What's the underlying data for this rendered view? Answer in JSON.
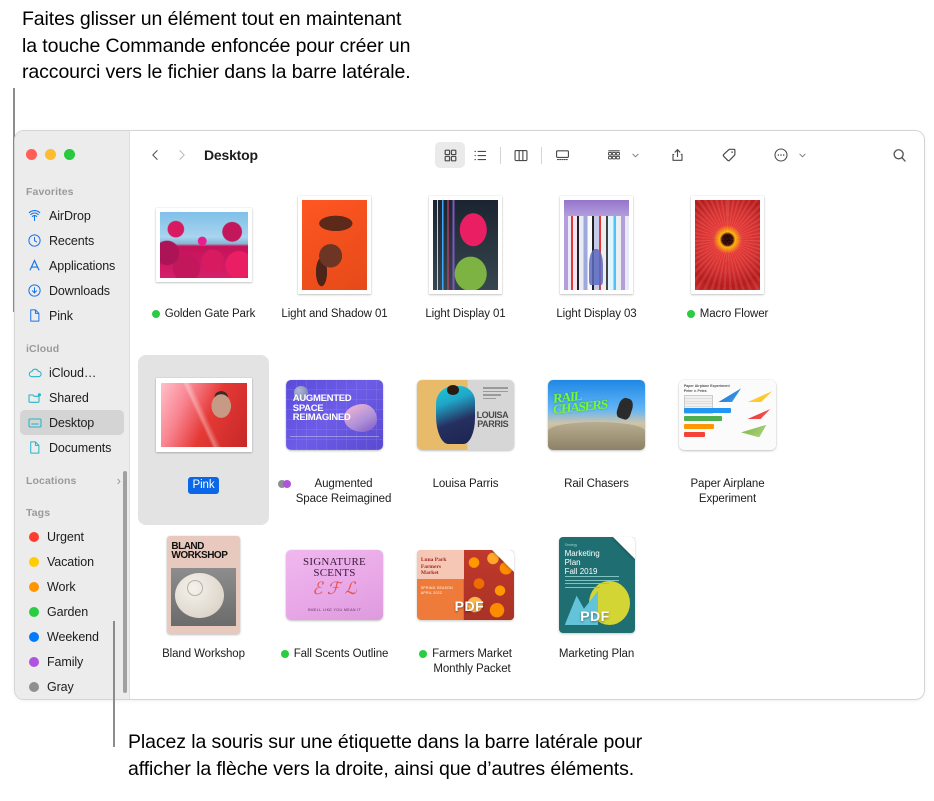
{
  "captions": {
    "top": "Faites glisser un élément tout en maintenant\nla touche Commande enfoncée pour créer un\nraccourci vers le fichier dans la barre latérale.",
    "bottom": "Placez la souris sur une étiquette dans la barre latérale pour\nafficher la flèche vers la droite, ainsi que d’autres éléments."
  },
  "window": {
    "traffic_lights": [
      "close",
      "minimize",
      "zoom"
    ],
    "colors": {
      "close": "#ff5f57",
      "minimize": "#febc2e",
      "zoom": "#28c840",
      "selection_blue": "#0a68e8",
      "sidebar_bg": "#ececec",
      "selected_row": "#d4d4d4"
    }
  },
  "sidebar": {
    "sections": [
      {
        "header": "Favorites",
        "items": [
          {
            "label": "AirDrop",
            "icon": "airdrop-icon",
            "selected": false
          },
          {
            "label": "Recents",
            "icon": "clock-icon",
            "selected": false
          },
          {
            "label": "Applications",
            "icon": "app-store-icon",
            "selected": false
          },
          {
            "label": "Downloads",
            "icon": "download-icon",
            "selected": false
          },
          {
            "label": "Pink",
            "icon": "document-icon",
            "selected": false
          }
        ]
      },
      {
        "header": "iCloud",
        "items": [
          {
            "label": "iCloud…",
            "icon": "cloud-icon",
            "selected": false
          },
          {
            "label": "Shared",
            "icon": "shared-folder-icon",
            "selected": false
          },
          {
            "label": "Desktop",
            "icon": "desktop-icon",
            "selected": true
          },
          {
            "label": "Documents",
            "icon": "document-icon",
            "selected": false
          }
        ]
      },
      {
        "header": "Locations",
        "chevron": "›",
        "items": []
      },
      {
        "header": "Tags",
        "items": [
          {
            "label": "Urgent",
            "icon": "tag-dot",
            "color": "#ff3b30"
          },
          {
            "label": "Vacation",
            "icon": "tag-dot",
            "color": "#ffcc00"
          },
          {
            "label": "Work",
            "icon": "tag-dot",
            "color": "#ff9500"
          },
          {
            "label": "Garden",
            "icon": "tag-dot",
            "color": "#28cd41"
          },
          {
            "label": "Weekend",
            "icon": "tag-dot",
            "color": "#007aff"
          },
          {
            "label": "Family",
            "icon": "tag-dot",
            "color": "#af52de"
          },
          {
            "label": "Gray",
            "icon": "tag-dot",
            "color": "#8e8e93"
          }
        ]
      }
    ]
  },
  "toolbar": {
    "back_icon": "chevron-left-icon",
    "forward_icon": "chevron-right-icon",
    "title": "Desktop",
    "view_buttons": [
      {
        "name": "icon-view",
        "active": true
      },
      {
        "name": "list-view",
        "active": false
      },
      {
        "name": "column-view",
        "active": false
      },
      {
        "name": "gallery-view",
        "active": false
      }
    ],
    "group_button": "group-by-icon",
    "share_button": "share-icon",
    "tag_button": "tag-icon",
    "more_button": "more-actions-icon",
    "search_button": "search-icon"
  },
  "files": [
    {
      "name": "Golden Gate Park",
      "art": "art-ggp",
      "thumb_type": "photo-landscape",
      "tags": [
        "#28cd41"
      ],
      "selected": false
    },
    {
      "name": "Light and Shadow 01",
      "art": "art-las",
      "thumb_type": "photo-portrait",
      "tags": [],
      "selected": false
    },
    {
      "name": "Light Display 01",
      "art": "art-ld1",
      "thumb_type": "photo-portrait",
      "tags": [],
      "selected": false
    },
    {
      "name": "Light Display 03",
      "art": "art-ld3",
      "thumb_type": "photo-portrait",
      "tags": [],
      "selected": false
    },
    {
      "name": "Macro Flower",
      "art": "art-mf",
      "thumb_type": "photo-portrait",
      "tags": [
        "#28cd41"
      ],
      "selected": false
    },
    {
      "name": "Pink",
      "art": "art-pink",
      "thumb_type": "photo-landscape",
      "tags": [],
      "selected": true
    },
    {
      "name": "Augmented\nSpace Reimagined",
      "art": "art-asr",
      "thumb_type": "doc-landscape",
      "tags": [
        "#8e8e93",
        "#af52de"
      ],
      "selected": false
    },
    {
      "name": "Louisa Parris",
      "art": "art-lp",
      "thumb_type": "doc-landscape",
      "tags": [],
      "selected": false
    },
    {
      "name": "Rail Chasers",
      "art": "art-rc",
      "thumb_type": "doc-landscape",
      "tags": [],
      "selected": false
    },
    {
      "name": "Paper Airplane\nExperiment",
      "art": "art-pae",
      "thumb_type": "doc-landscape",
      "tags": [],
      "selected": false
    },
    {
      "name": "Bland Workshop",
      "art": "art-bw",
      "thumb_type": "doc-portrait",
      "tags": [],
      "selected": false
    },
    {
      "name": "Fall Scents Outline",
      "art": "art-ss",
      "thumb_type": "doc-landscape",
      "tags": [
        "#28cd41"
      ],
      "selected": false
    },
    {
      "name": "Farmers Market\nMonthly Packet",
      "art": "art-fm",
      "thumb_type": "pdf-landscape",
      "badge": "PDF",
      "tags": [
        "#28cd41"
      ],
      "selected": false
    },
    {
      "name": "Marketing Plan",
      "art": "art-mp",
      "thumb_type": "pdf-portrait",
      "badge": "PDF",
      "tags": [],
      "selected": false
    }
  ],
  "artwork_text": {
    "augmented_space": "AUGMENTED\nSPACE\nREIMAGINED",
    "louisa_parris": "LOUISA\nPARRIS",
    "rail_chasers": "RAIL\nCHASERS",
    "bland_workshop": "BLAND\nWORKSHOP",
    "signature_scents_title": "SIGNATURE\nSCENTS",
    "signature_scents_script": "ℰ ℱ ℒ",
    "signature_scents_sub": "SMELL LIKE YOU MEAN IT",
    "farmers_market": "Luna Park\nFarmers Market",
    "farmers_market_sub": "SPRING SEASON\nAPRIL 2022",
    "marketing_plan_kicker": "Strategy",
    "marketing_plan": "Marketing\nPlan\nFall 2019",
    "paper_airplane_head": "Paper Airplane Experiment\nPeter v. Petra"
  }
}
